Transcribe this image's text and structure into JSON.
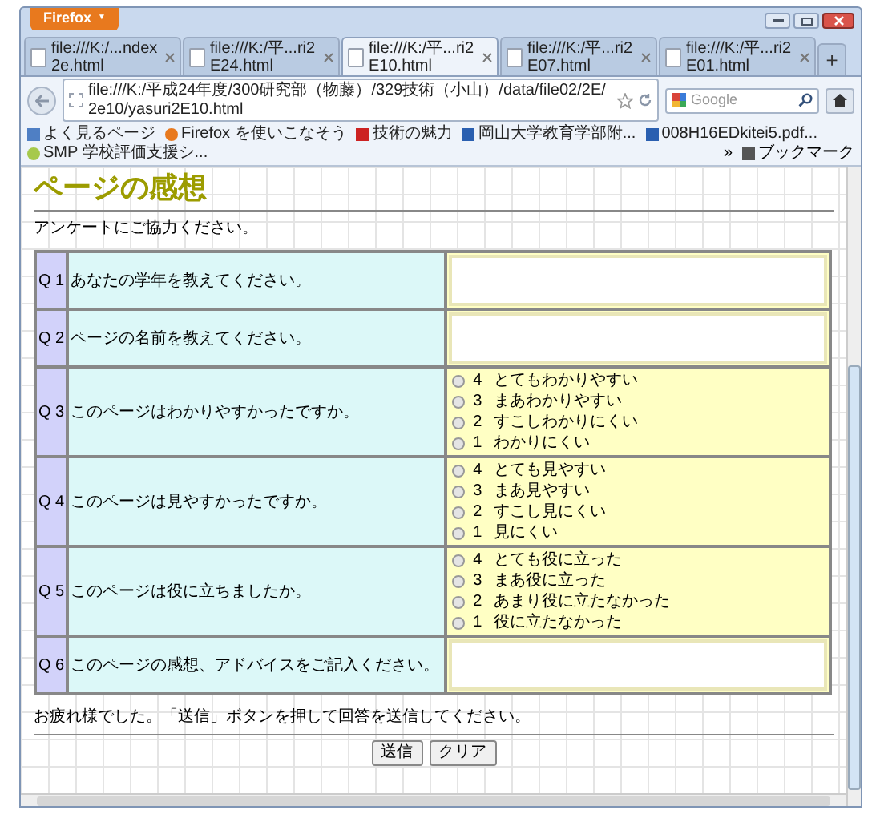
{
  "window": {
    "app_button": "Firefox",
    "app_button_caret": "▼"
  },
  "tabs": [
    {
      "label": "file:///K:/...ndex2e.html",
      "selected": false
    },
    {
      "label": "file:///K:/平...ri2E24.html",
      "selected": false
    },
    {
      "label": "file:///K:/平...ri2E10.html",
      "selected": true
    },
    {
      "label": "file:///K:/平...ri2E07.html",
      "selected": false
    },
    {
      "label": "file:///K:/平...ri2E01.html",
      "selected": false
    }
  ],
  "new_tab": "+",
  "address_bar": {
    "value": "file:///K:/平成24年度/300研究部（物藤）/329技術（小山）/data/file02/2E/2e10/yasuri2E10.html"
  },
  "search": {
    "placeholder": "Google"
  },
  "bookmarks": {
    "items": [
      "よく見るページ",
      "Firefox を使いこなそう",
      "技術の魅力",
      "岡山大学教育学部附...",
      "008H16EDkitei5.pdf...",
      "SMP 学校評価支援シ..."
    ],
    "more": "»",
    "menu": "ブックマーク"
  },
  "page": {
    "title": "ページの感想",
    "intro": "アンケートにご協力ください。",
    "questions": [
      {
        "number": "Q 1",
        "text": "あなたの学年を教えてください。",
        "kind": "text"
      },
      {
        "number": "Q 2",
        "text": "ページの名前を教えてください。",
        "kind": "text"
      },
      {
        "number": "Q 3",
        "text": "このページはわかりやすかったですか。",
        "kind": "choice",
        "options": [
          {
            "score": "4",
            "label": "とてもわかりやすい",
            "selected": false
          },
          {
            "score": "3",
            "label": "まあわかりやすい",
            "selected": false
          },
          {
            "score": "2",
            "label": "すこしわかりにくい",
            "selected": false
          },
          {
            "score": "1",
            "label": "わかりにくい",
            "selected": false
          }
        ]
      },
      {
        "number": "Q 4",
        "text": "このページは見やすかったですか。",
        "kind": "choice",
        "options": [
          {
            "score": "4",
            "label": "とても見やすい",
            "selected": false
          },
          {
            "score": "3",
            "label": "まあ見やすい",
            "selected": false
          },
          {
            "score": "2",
            "label": "すこし見にくい",
            "selected": false
          },
          {
            "score": "1",
            "label": "見にくい",
            "selected": false
          }
        ]
      },
      {
        "number": "Q 5",
        "text": "このページは役に立ちましたか。",
        "kind": "choice",
        "options": [
          {
            "score": "4",
            "label": "とても役に立った",
            "selected": false
          },
          {
            "score": "3",
            "label": "まあ役に立った",
            "selected": false
          },
          {
            "score": "2",
            "label": "あまり役に立たなかった",
            "selected": false
          },
          {
            "score": "1",
            "label": "役に立たなかった",
            "selected": false
          }
        ]
      },
      {
        "number": "Q 6",
        "text": "このページの感想、アドバイスをご記入ください。",
        "kind": "text"
      }
    ],
    "closing": "お疲れ様でした。「送信」ボタンを押して回答を送信してください。",
    "buttons": [
      "送信",
      "クリア"
    ]
  }
}
